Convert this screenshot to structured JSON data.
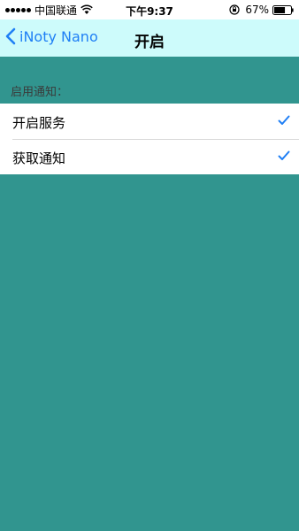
{
  "status_bar": {
    "carrier": "中国联通",
    "time": "下午9:37",
    "battery_percent": "67%",
    "battery_level": 0.67,
    "icons": [
      "signal-dots-icon",
      "wifi-icon",
      "rotation-lock-icon",
      "battery-icon"
    ]
  },
  "nav": {
    "back_label": "iNoty Nano",
    "title": "开启",
    "back_icon": "chevron-left-icon"
  },
  "section": {
    "header": "启用通知："
  },
  "items": [
    {
      "label": "开启服务",
      "checked": true,
      "icon": "checkmark-icon"
    },
    {
      "label": "获取通知",
      "checked": true,
      "icon": "checkmark-icon"
    }
  ],
  "colors": {
    "background": "#31958f",
    "nav_background": "#cdfbfb",
    "accent": "#1f7ff5"
  }
}
